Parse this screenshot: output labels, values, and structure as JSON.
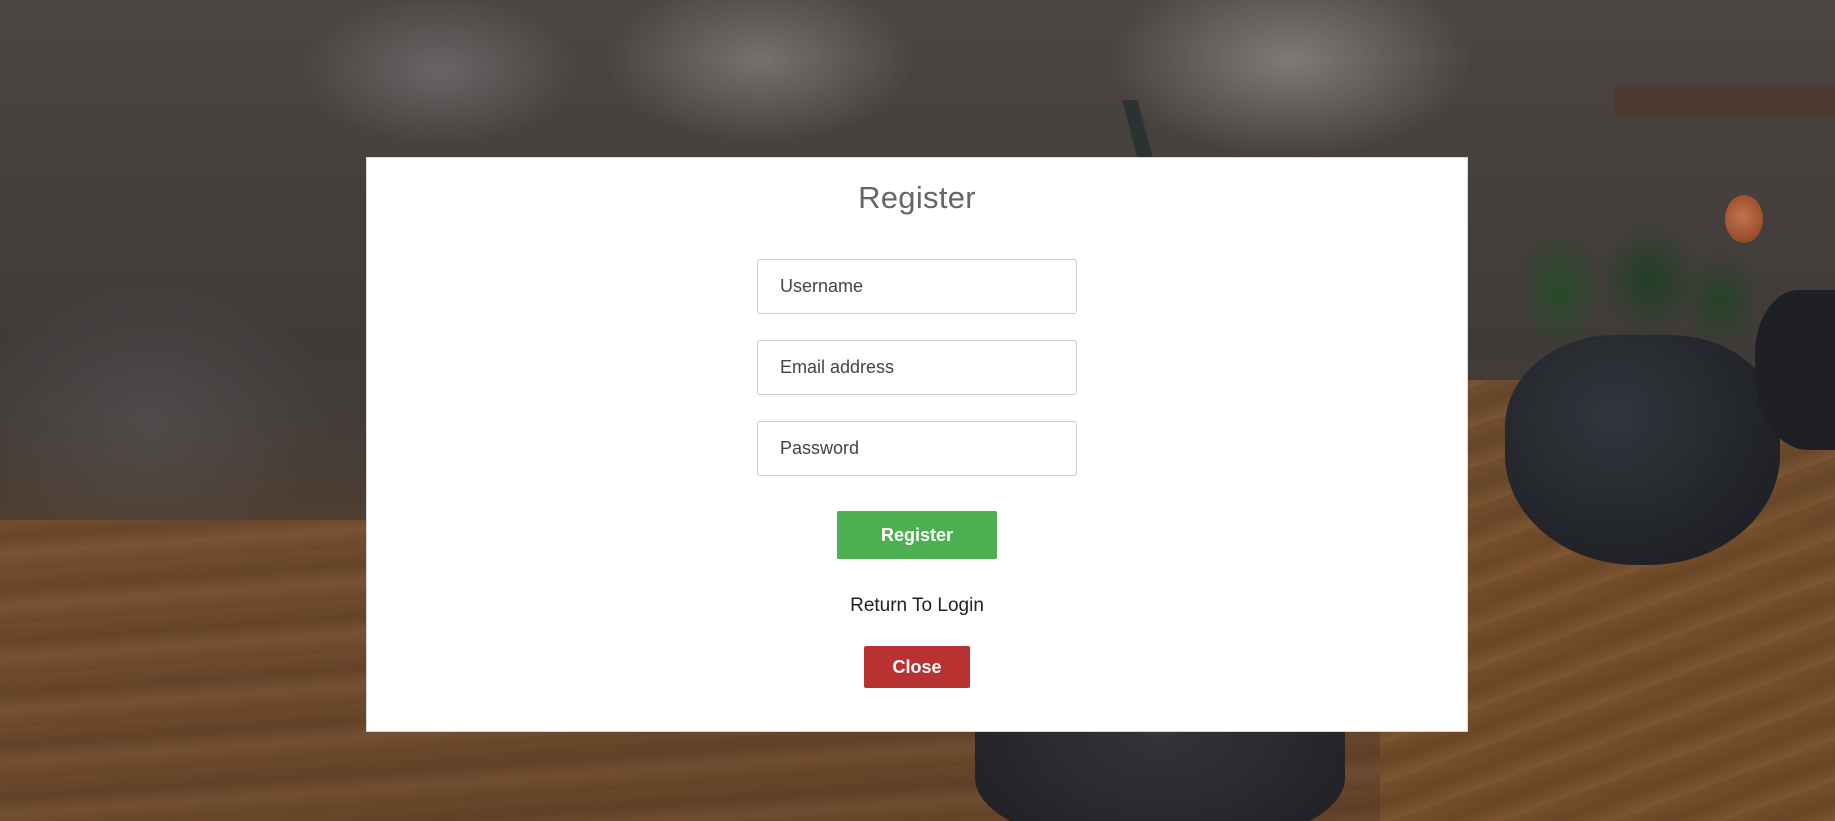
{
  "background": {
    "description_icon": "office-desk-photo"
  },
  "modal": {
    "title": "Register",
    "username": {
      "placeholder": "Username",
      "value": ""
    },
    "email": {
      "placeholder": "Email address",
      "value": ""
    },
    "password": {
      "placeholder": "Password",
      "value": ""
    },
    "register_label": "Register",
    "return_login_label": "Return To Login",
    "close_label": "Close"
  },
  "colors": {
    "register_button": "#4caf50",
    "close_button": "#b83232",
    "title_text": "#666666"
  }
}
